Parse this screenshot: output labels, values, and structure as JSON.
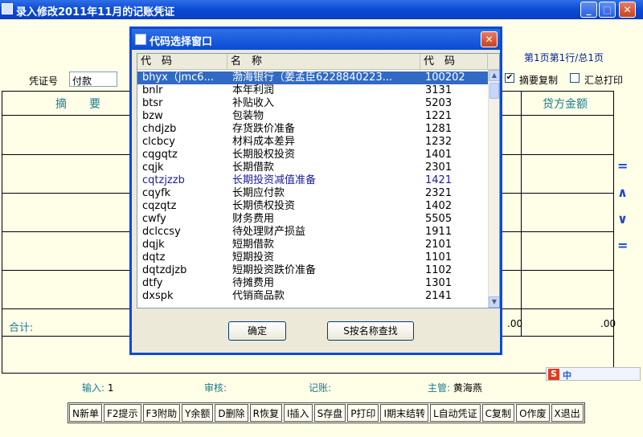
{
  "window": {
    "title": "录入修改2011年11月的记账凭证",
    "min": "_",
    "max": "□",
    "close": "✕"
  },
  "form": {
    "page_info": "第1页第1行/总1页",
    "voucher_no_label": "凭证号",
    "voucher_type": "付款",
    "copy_summary_label": "摘要复制",
    "summary_print_label": "汇总打印",
    "col_summary": "摘　　要",
    "col_credit": "贷方金额",
    "total_label": "合计:",
    "total_debit": ".00",
    "total_credit": ".00"
  },
  "nav": {
    "first": "=",
    "prev": "∧",
    "next": "∨",
    "last": "="
  },
  "status": {
    "input_label": "输入:",
    "input_value": "1",
    "review_label": "审核:",
    "post_label": "记账:",
    "supervisor_label": "主管:",
    "supervisor_value": "黄海燕"
  },
  "toolbar": [
    "N新单",
    "F2提示",
    "F3附助",
    "Y余额",
    "D删除",
    "R恢复",
    "I插入",
    "S存盘",
    "P打印",
    "I期末结转",
    "L自动凭证",
    "C复制",
    "O作废",
    "X退出"
  ],
  "ime": {
    "s": "S",
    "z": "中"
  },
  "dialog": {
    "title": "代码选择窗口",
    "close": "✕",
    "headers": [
      "代　码",
      "名　称",
      "代　码"
    ],
    "ok_button": "确定",
    "search_button": "S按名称查找",
    "rows": [
      {
        "code": "bhyx（jmc6...",
        "name": "渤海银行（姜孟臣6228840223...",
        "num": "100202"
      },
      {
        "code": "bnlr",
        "name": "本年利润",
        "num": "3131"
      },
      {
        "code": "btsr",
        "name": "补贴收入",
        "num": "5203"
      },
      {
        "code": "bzw",
        "name": "包装物",
        "num": "1221"
      },
      {
        "code": "chdjzb",
        "name": "存货跌价准备",
        "num": "1281"
      },
      {
        "code": "clcbcy",
        "name": "材料成本差异",
        "num": "1232"
      },
      {
        "code": "cqgqtz",
        "name": "长期股权投资",
        "num": "1401"
      },
      {
        "code": "cqjk",
        "name": "长期借款",
        "num": "2301"
      },
      {
        "code": "cqtzjzzb",
        "name": "长期投资减值准备",
        "num": "1421"
      },
      {
        "code": "cqyfk",
        "name": "长期应付款",
        "num": "2321"
      },
      {
        "code": "cqzqtz",
        "name": "长期债权投资",
        "num": "1402"
      },
      {
        "code": "cwfy",
        "name": "财务费用",
        "num": "5505"
      },
      {
        "code": "dclccsy",
        "name": "待处理财产损益",
        "num": "1911"
      },
      {
        "code": "dqjk",
        "name": "短期借款",
        "num": "2101"
      },
      {
        "code": "dqtz",
        "name": "短期投资",
        "num": "1101"
      },
      {
        "code": "dqtzdjzb",
        "name": "短期投资跌价准备",
        "num": "1102"
      },
      {
        "code": "dtfy",
        "name": "待摊费用",
        "num": "1301"
      },
      {
        "code": "dxspk",
        "name": "代销商品款",
        "num": "2141"
      }
    ]
  }
}
